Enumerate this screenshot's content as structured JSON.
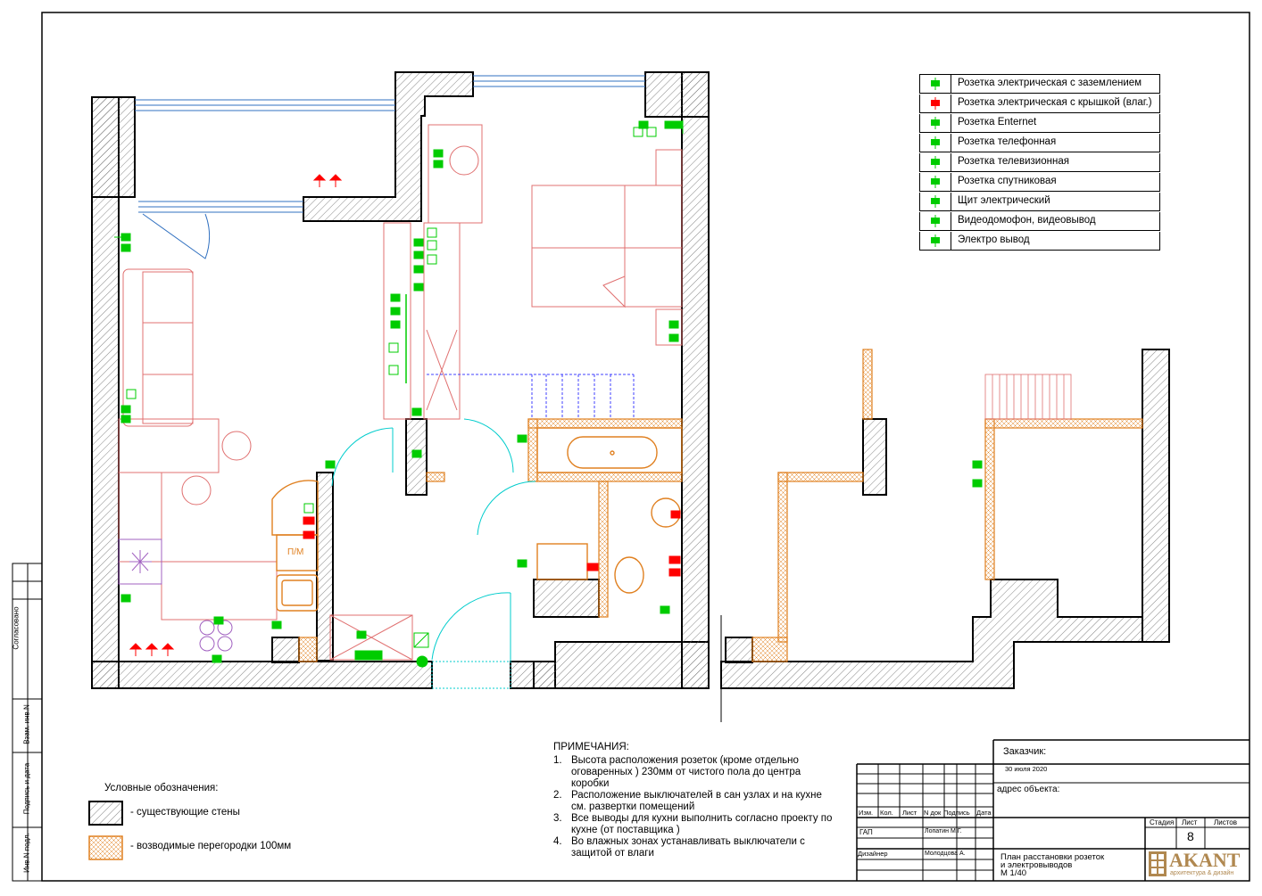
{
  "legend": {
    "items": [
      {
        "label": "Розетка электрическая с заземлением",
        "icon": "grounded-outlet-icon",
        "color": "#00cc00"
      },
      {
        "label": "Розетка электрическая с крышкой (влаг.)",
        "icon": "waterproof-outlet-icon",
        "color": "#ff0000"
      },
      {
        "label": "Розетка Enternet",
        "icon": "ethernet-outlet-icon",
        "color": "#00cc00"
      },
      {
        "label": "Розетка телефонная",
        "icon": "phone-outlet-icon",
        "color": "#00cc00"
      },
      {
        "label": "Розетка телевизионная",
        "icon": "tv-outlet-icon",
        "color": "#00cc00"
      },
      {
        "label": "Розетка спутниковая",
        "icon": "satellite-outlet-icon",
        "color": "#00cc00"
      },
      {
        "label": "Щит электрический",
        "icon": "electrical-panel-icon",
        "color": "#00cc00"
      },
      {
        "label": "Видеодомофон, видеовывод",
        "icon": "video-intercom-icon",
        "color": "#00cc00"
      },
      {
        "label": "Электро вывод",
        "icon": "electrical-outlet-point-icon",
        "color": "#00cc00"
      }
    ]
  },
  "conventions": {
    "title": "Условные обозначения:",
    "existing_walls": "- существующие стены",
    "partitions": "- возводимые перегородки 100мм"
  },
  "notes": {
    "title": "ПРИМЕЧАНИЯ:",
    "items": [
      {
        "n": "1.",
        "text": "Высота расположения розеток  (кроме отдельно оговаренных ) 230мм от чистого пола до центра коробки"
      },
      {
        "n": "2.",
        "text": "Расположение выключателей в сан узлах и на кухне см. развертки помещений"
      },
      {
        "n": "3.",
        "text": "Все выводы для кухни выполнить согласно проекту по кухне (от поставщика )"
      },
      {
        "n": "4.",
        "text": "Во влажных зонах устанавливать выключатели с защитой от влаги"
      }
    ]
  },
  "plan": {
    "kitchen_label": "П/М"
  },
  "left_strip": {
    "agreed": "Согласовано",
    "inv_replace": "Взам. инв.N",
    "sign_date": "Подпись и дата",
    "inv_orig": "Инв.N подл."
  },
  "title_block": {
    "customer_label": "Заказчик:",
    "date": "30 июля 2020",
    "address_label": "адрес объекта:",
    "cols": [
      "Изм.",
      "Кол.",
      "Лист",
      "N док",
      "Подпись",
      "Дата"
    ],
    "gap_role": "ГАП",
    "gap_name": "Лопатин М.Г.",
    "designer_role": "Дизайнер",
    "designer_name": "Молодцова А.",
    "stage_label": "Стадия",
    "sheet_label": "Лист",
    "sheets_label": "Листов",
    "sheet_number": "8",
    "drawing_title_1": "План расстановки розеток",
    "drawing_title_2": "и электровыводов",
    "scale": "М 1/40",
    "logo_text": "AKANT",
    "logo_sub": "архитектура & дизайн"
  },
  "colors": {
    "outlet": "#00cc00",
    "waterproof": "#ff0000",
    "furniture": "#e07070",
    "partition": "#e08020",
    "window": "#3070c0",
    "door": "#00cccc",
    "stairs": "#4040ff"
  }
}
